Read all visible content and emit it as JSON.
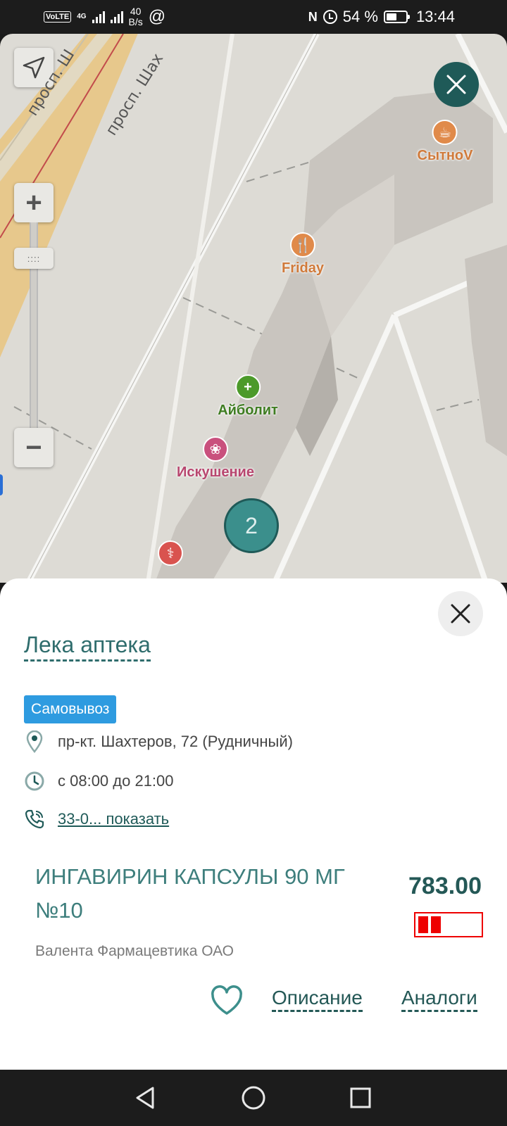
{
  "status_bar": {
    "volte": "VoLTE",
    "network": "4G",
    "speed_value": "40",
    "speed_unit": "B/s",
    "at_symbol": "@",
    "nfc": "N",
    "battery_percent": "54 %",
    "battery_level": 0.54,
    "time": "13:44"
  },
  "map": {
    "streets": [
      "просп. Ш",
      "просп. Шах"
    ],
    "pois": [
      {
        "label": "СытноV",
        "icon": "cafe-icon",
        "color": "#e08a4a"
      },
      {
        "label": "Friday",
        "icon": "restaurant-icon",
        "color": "#e08a4a"
      },
      {
        "label": "Айболит",
        "icon": "pharmacy-cross-icon",
        "color": "#4c9a2a"
      },
      {
        "label": "Искушение",
        "icon": "lotus-icon",
        "color": "#c9507d"
      },
      {
        "label": "",
        "icon": "tooth-icon",
        "color": "#d9534f"
      }
    ],
    "cluster_count": "2",
    "zoom_handle": "::::",
    "zoom_in": "+",
    "zoom_out": "−"
  },
  "sheet": {
    "pharmacy_name": "Лека аптека",
    "badge": "Самовывоз",
    "address": "пр-кт. Шахтеров, 72 (Рудничный)",
    "hours": "с 08:00 до 21:00",
    "phone": "33-0... показать",
    "product_name": "ИНГАВИРИН КАПСУЛЫ 90 МГ №10",
    "manufacturer": "Валента Фармацевтика ОАО",
    "price": "783.00",
    "stock_level": 0.4,
    "description_link": "Описание",
    "analogs_link": "Аналоги"
  },
  "colors": {
    "accent": "#1f5a58",
    "badge": "#2e9be0",
    "stock": "#e00000"
  }
}
